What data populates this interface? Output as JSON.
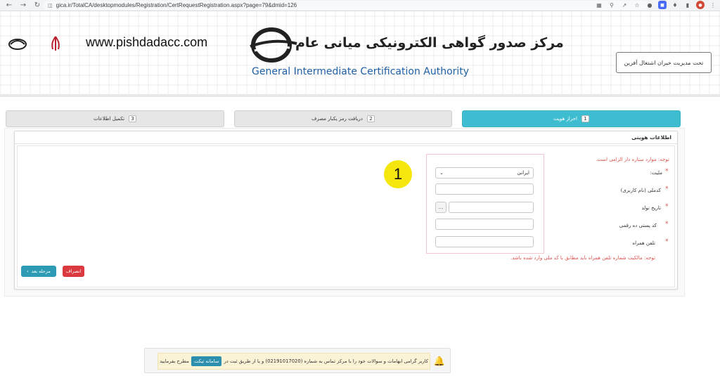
{
  "browser": {
    "url": "gica.ir/TotalCA/desktopmodules/Registration/CertRequestRegistration.aspx?page=79&dmid=126",
    "back_icon": "arrow-left-icon",
    "forward_icon": "arrow-right-icon",
    "reload_icon": "reload-icon"
  },
  "header": {
    "website": "www.pishdadacc.com",
    "title_fa": "مرکز صدور گواهی الکترونیکی میانی عام",
    "title_en": "General Intermediate Certification Authority",
    "right_logo_text": "تحت مدیریت خیران اشتغال آفرین"
  },
  "steps": [
    {
      "number": "1",
      "label": "احراز هویت"
    },
    {
      "number": "2",
      "label": "دریافت رمز یکبار مصرف"
    },
    {
      "number": "3",
      "label": "تکمیل اطلاعات"
    }
  ],
  "form": {
    "section_title": "اطلاعات هویتی",
    "note_required": "توجه: موارد ستاره دار الزامی است.",
    "fields": {
      "nationality_label": "ملیت:",
      "nationality_value": "ایرانی",
      "national_code_label": "کدملی (نام کاربری)",
      "birth_date_label": "تاریخ تولد",
      "postal_code_label": "کد پستی ده رقمی",
      "mobile_label": "تلفن همراه",
      "date_button": "..."
    },
    "note_mobile": "توجه: مالکیت شماره تلفن همراه باید مطابق با کد ملی وارد شده باشد.",
    "required_mark": "*",
    "marker_number": "1"
  },
  "buttons": {
    "next": "مرحله بعد",
    "cancel": "انصراف"
  },
  "notice": {
    "text_before": "کاربر گرامی ابهامات و سوالات خود را با مرکز تماس به شماره (02191017020) و یا از طریق ثبت در",
    "ticket": "سامانه تیکت",
    "text_after": "مطرح بفرمایید"
  }
}
